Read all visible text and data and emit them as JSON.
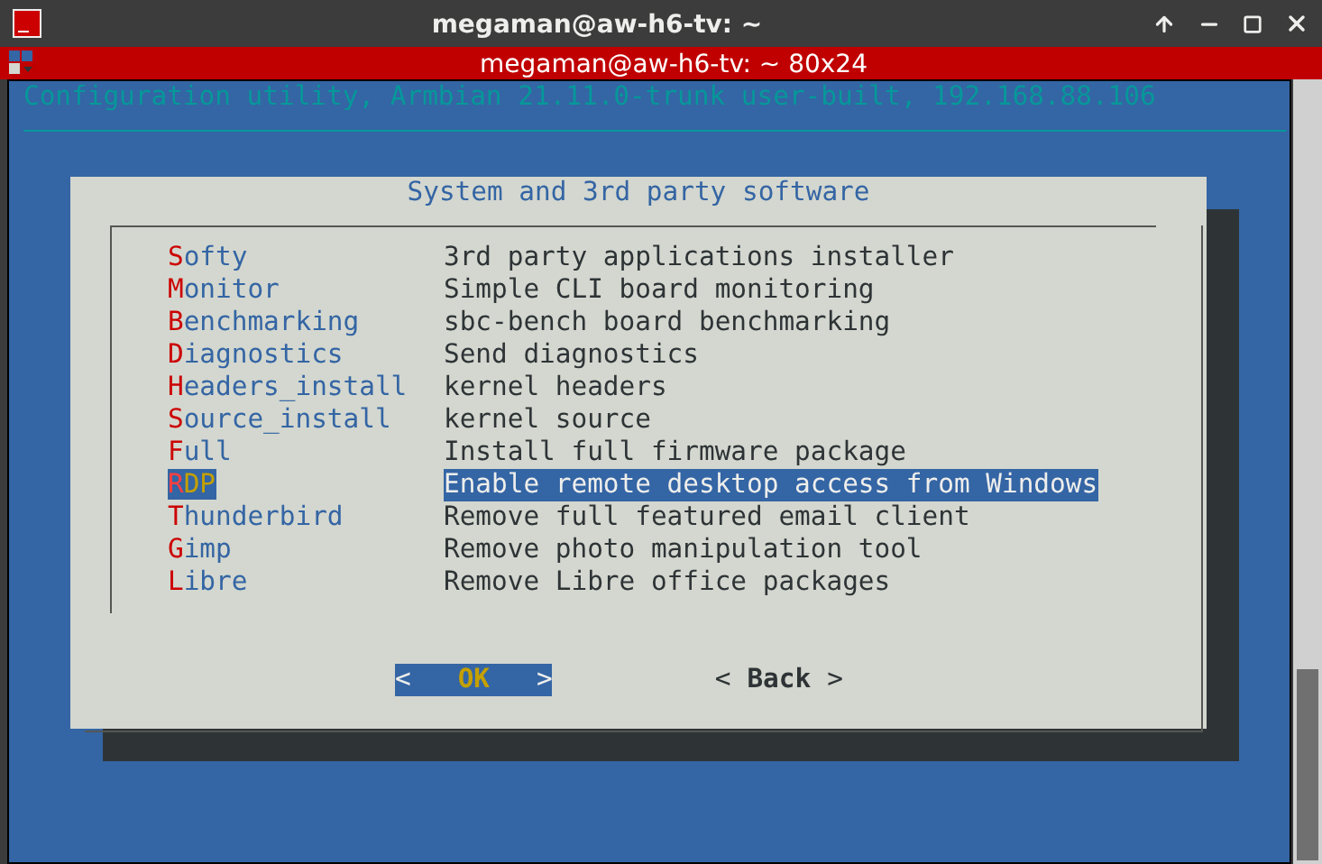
{
  "window": {
    "title": "megaman@aw-h6-tv: ~"
  },
  "tab": {
    "title": "megaman@aw-h6-tv: ~ 80x24"
  },
  "terminal": {
    "header": "Configuration utility, Armbian 21.11.0-trunk user-built, 192.168.88.106"
  },
  "dialog": {
    "title": "System and 3rd party software",
    "items": [
      {
        "key": "S",
        "label": "ofty",
        "description": "3rd party applications installer",
        "selected": false
      },
      {
        "key": "M",
        "label": "onitor",
        "description": "Simple CLI board monitoring",
        "selected": false
      },
      {
        "key": "B",
        "label": "enchmarking",
        "description": "sbc-bench board benchmarking",
        "selected": false
      },
      {
        "key": "D",
        "label": "iagnostics",
        "description": "Send diagnostics",
        "selected": false
      },
      {
        "key": "H",
        "label": "eaders_install",
        "description": "kernel headers",
        "selected": false
      },
      {
        "key": "S",
        "label": "ource_install",
        "description": "kernel source",
        "selected": false
      },
      {
        "key": "F",
        "label": "ull",
        "description": "Install full firmware package",
        "selected": false
      },
      {
        "key": "R",
        "label": "DP",
        "description": "Enable remote desktop access from Windows",
        "selected": true
      },
      {
        "key": "T",
        "label": "hunderbird",
        "description": "Remove full featured email client",
        "selected": false
      },
      {
        "key": "G",
        "label": "imp",
        "description": "Remove photo manipulation tool",
        "selected": false
      },
      {
        "key": "L",
        "label": "ibre",
        "description": "Remove Libre office packages",
        "selected": false
      }
    ],
    "buttons": [
      {
        "open": "<",
        "label": "OK",
        "close": ">",
        "selected": true
      },
      {
        "open": "<",
        "label": "Back",
        "close": ">",
        "selected": false
      }
    ]
  }
}
